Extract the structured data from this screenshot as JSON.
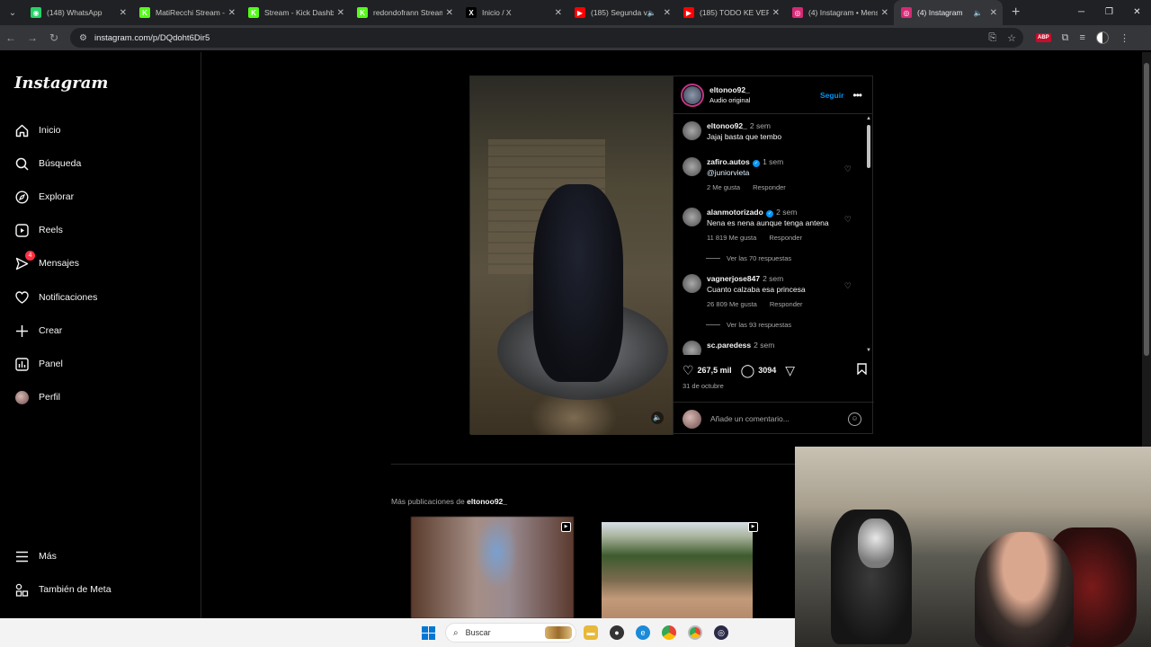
{
  "browser": {
    "tabs": [
      {
        "title": "(148) WhatsApp",
        "icon": "whatsapp-icon",
        "color": "#25d366",
        "glyph": "◉",
        "speaker": false
      },
      {
        "title": "MatiRecchi Stream - K",
        "icon": "kick-icon",
        "color": "#53fc18",
        "glyph": "K",
        "speaker": false
      },
      {
        "title": "Stream - Kick Dashbo",
        "icon": "kick-icon",
        "color": "#53fc18",
        "glyph": "K",
        "speaker": false
      },
      {
        "title": "redondofrann Stream",
        "icon": "kick-icon",
        "color": "#53fc18",
        "glyph": "K",
        "speaker": false
      },
      {
        "title": "Inicio / X",
        "icon": "x-icon",
        "color": "#000000",
        "glyph": "X",
        "speaker": false
      },
      {
        "title": "(185) Segunda vo",
        "icon": "youtube-icon",
        "color": "#ff0000",
        "glyph": "▶",
        "speaker": true
      },
      {
        "title": "(185) TODO KE VER C",
        "icon": "youtube-icon",
        "color": "#ff0000",
        "glyph": "▶",
        "speaker": false
      },
      {
        "title": "(4) Instagram • Mens",
        "icon": "instagram-icon",
        "color": "#d62976",
        "glyph": "◎",
        "speaker": false
      },
      {
        "title": "(4) Instagram",
        "icon": "instagram-icon",
        "color": "#d62976",
        "glyph": "◎",
        "speaker": true,
        "active": true
      }
    ],
    "url": "instagram.com/p/DQdoht6Dir5"
  },
  "sidebar": {
    "logo": "Instagram",
    "items": [
      {
        "label": "Inicio",
        "icon": "home-icon"
      },
      {
        "label": "Búsqueda",
        "icon": "search-icon"
      },
      {
        "label": "Explorar",
        "icon": "compass-icon"
      },
      {
        "label": "Reels",
        "icon": "reels-icon"
      },
      {
        "label": "Mensajes",
        "icon": "messenger-icon",
        "badge": "4"
      },
      {
        "label": "Notificaciones",
        "icon": "heart-icon"
      },
      {
        "label": "Crear",
        "icon": "plus-icon"
      },
      {
        "label": "Panel",
        "icon": "dashboard-icon"
      },
      {
        "label": "Perfil",
        "icon": "avatar"
      }
    ],
    "more": "Más",
    "meta": "También de Meta"
  },
  "post": {
    "author": "eltonoo92_",
    "audio": "Audio original",
    "follow": "Seguir",
    "comments": [
      {
        "user": "eltonoo92_",
        "verified": false,
        "time": "2 sem",
        "text": "Jajaj basta que tembo"
      },
      {
        "user": "zafiro.autos",
        "verified": true,
        "time": "1 sem",
        "mention": "@juniorvieta",
        "likes": "2 Me gusta",
        "reply": "Responder"
      },
      {
        "user": "alanmotorizado",
        "verified": true,
        "time": "2 sem",
        "text": "Nena es nena aunque tenga antena",
        "likes": "11 819 Me gusta",
        "reply": "Responder",
        "replies": "Ver las 70 respuestas"
      },
      {
        "user": "vagnerjose847",
        "verified": false,
        "time": "2 sem",
        "text": "Cuanto calzaba esa princesa",
        "likes": "26 809 Me gusta",
        "reply": "Responder",
        "replies": "Ver las 93 respuestas"
      },
      {
        "user": "sc.paredess",
        "verified": false,
        "time": "2 sem"
      }
    ],
    "likes_count": "267,5 mil",
    "comments_count": "3094",
    "date": "31 de octubre",
    "add_comment_placeholder": "Añade un comentario..."
  },
  "more_posts": {
    "prefix": "Más publicaciones de",
    "user": "eltonoo92_"
  },
  "taskbar": {
    "search_placeholder": "Buscar"
  }
}
